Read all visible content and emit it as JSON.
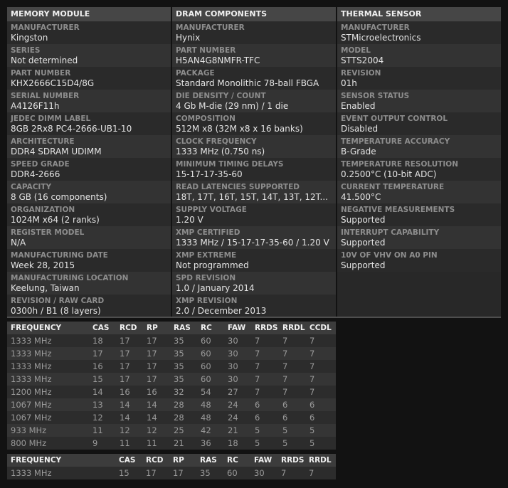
{
  "memory_module": {
    "header": "MEMORY MODULE",
    "fields": [
      {
        "label": "MANUFACTURER",
        "value": "Kingston"
      },
      {
        "label": "SERIES",
        "value": "Not determined"
      },
      {
        "label": "PART NUMBER",
        "value": "KHX2666C15D4/8G"
      },
      {
        "label": "SERIAL NUMBER",
        "value": "A4126F11h"
      },
      {
        "label": "JEDEC DIMM LABEL",
        "value": "8GB 2Rx8 PC4-2666-UB1-10"
      },
      {
        "label": "ARCHITECTURE",
        "value": "DDR4 SDRAM UDIMM"
      },
      {
        "label": "SPEED GRADE",
        "value": "DDR4-2666"
      },
      {
        "label": "CAPACITY",
        "value": "8 GB (16 components)"
      },
      {
        "label": "ORGANIZATION",
        "value": "1024M x64 (2 ranks)"
      },
      {
        "label": "REGISTER MODEL",
        "value": "N/A"
      },
      {
        "label": "MANUFACTURING DATE",
        "value": "Week 28, 2015"
      },
      {
        "label": "MANUFACTURING LOCATION",
        "value": "Keelung, Taiwan"
      },
      {
        "label": "REVISION / RAW CARD",
        "value": "0300h / B1 (8 layers)"
      }
    ]
  },
  "dram_components": {
    "header": "DRAM COMPONENTS",
    "fields": [
      {
        "label": "MANUFACTURER",
        "value": "Hynix"
      },
      {
        "label": "PART NUMBER",
        "value": "H5AN4G8NMFR-TFC"
      },
      {
        "label": "PACKAGE",
        "value": "Standard Monolithic 78-ball FBGA"
      },
      {
        "label": "DIE DENSITY / COUNT",
        "value": "4 Gb M-die (29 nm) / 1 die"
      },
      {
        "label": "COMPOSITION",
        "value": "512M x8 (32M x8 x 16 banks)"
      },
      {
        "label": "CLOCK FREQUENCY",
        "value": "1333 MHz (0.750 ns)"
      },
      {
        "label": "MINIMUM TIMING DELAYS",
        "value": "15-17-17-35-60"
      },
      {
        "label": "READ LATENCIES SUPPORTED",
        "value": "18T, 17T, 16T, 15T, 14T, 13T, 12T..."
      },
      {
        "label": "SUPPLY VOLTAGE",
        "value": "1.20 V"
      },
      {
        "label": "XMP CERTIFIED",
        "value": "1333 MHz / 15-17-17-35-60 / 1.20 V"
      },
      {
        "label": "XMP EXTREME",
        "value": "Not programmed"
      },
      {
        "label": "SPD REVISION",
        "value": "1.0 / January 2014"
      },
      {
        "label": "XMP REVISION",
        "value": "2.0 / December 2013"
      }
    ]
  },
  "thermal_sensor": {
    "header": "THERMAL SENSOR",
    "fields": [
      {
        "label": "MANUFACTURER",
        "value": "STMicroelectronics"
      },
      {
        "label": "MODEL",
        "value": "STTS2004"
      },
      {
        "label": "REVISION",
        "value": "01h"
      },
      {
        "label": "SENSOR STATUS",
        "value": "Enabled"
      },
      {
        "label": "EVENT OUTPUT CONTROL",
        "value": "Disabled"
      },
      {
        "label": "TEMPERATURE ACCURACY",
        "value": "B-Grade"
      },
      {
        "label": "TEMPERATURE RESOLUTION",
        "value": "0.2500°C (10-bit ADC)"
      },
      {
        "label": "CURRENT TEMPERATURE",
        "value": "41.500°C"
      },
      {
        "label": "NEGATIVE MEASUREMENTS",
        "value": "Supported"
      },
      {
        "label": "INTERRUPT CAPABILITY",
        "value": "Supported"
      },
      {
        "label": "10V OF VHV ON A0 PIN",
        "value": "Supported"
      }
    ]
  },
  "jedec_timings": {
    "columns": [
      "FREQUENCY",
      "CAS",
      "RCD",
      "RP",
      "RAS",
      "RC",
      "FAW",
      "RRDS",
      "RRDL",
      "CCDL"
    ],
    "rows": [
      [
        "1333 MHz",
        "18",
        "17",
        "17",
        "35",
        "60",
        "30",
        "7",
        "7",
        "7"
      ],
      [
        "1333 MHz",
        "17",
        "17",
        "17",
        "35",
        "60",
        "30",
        "7",
        "7",
        "7"
      ],
      [
        "1333 MHz",
        "16",
        "17",
        "17",
        "35",
        "60",
        "30",
        "7",
        "7",
        "7"
      ],
      [
        "1333 MHz",
        "15",
        "17",
        "17",
        "35",
        "60",
        "30",
        "7",
        "7",
        "7"
      ],
      [
        "1200 MHz",
        "14",
        "16",
        "16",
        "32",
        "54",
        "27",
        "7",
        "7",
        "7"
      ],
      [
        "1067 MHz",
        "13",
        "14",
        "14",
        "28",
        "48",
        "24",
        "6",
        "6",
        "6"
      ],
      [
        "1067 MHz",
        "12",
        "14",
        "14",
        "28",
        "48",
        "24",
        "6",
        "6",
        "6"
      ],
      [
        "933 MHz",
        "11",
        "12",
        "12",
        "25",
        "42",
        "21",
        "5",
        "5",
        "5"
      ],
      [
        "800 MHz",
        "9",
        "11",
        "11",
        "21",
        "36",
        "18",
        "5",
        "5",
        "5"
      ]
    ]
  },
  "xmp_timings": {
    "columns": [
      "FREQUENCY",
      "CAS",
      "RCD",
      "RP",
      "RAS",
      "RC",
      "FAW",
      "RRDS",
      "RRDL"
    ],
    "rows": [
      [
        "1333 MHz",
        "15",
        "17",
        "17",
        "35",
        "60",
        "30",
        "7",
        "7"
      ]
    ]
  }
}
